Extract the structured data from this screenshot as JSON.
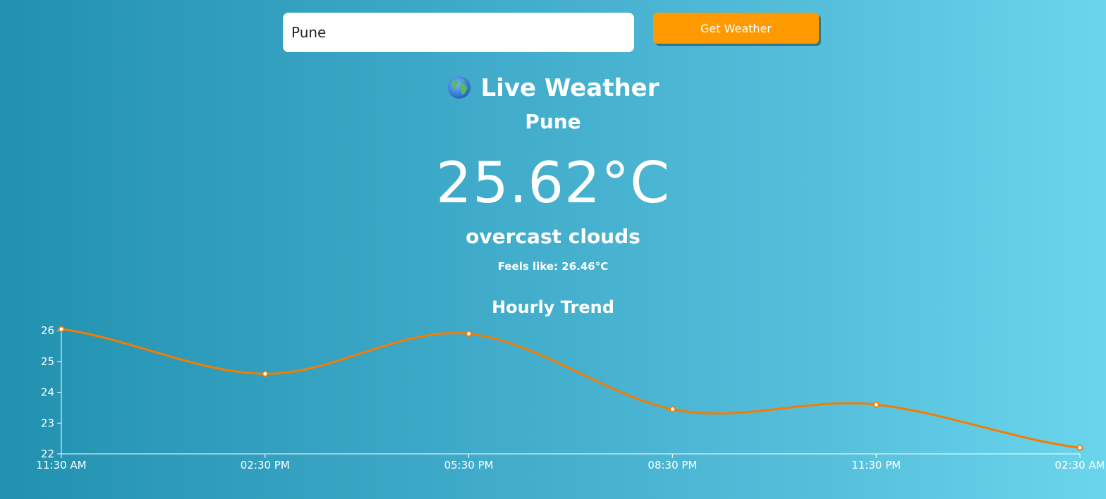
{
  "search": {
    "value": "Pune",
    "placeholder": "",
    "button_label": "Get Weather"
  },
  "header": {
    "title": "Live Weather",
    "icon": "globe-icon"
  },
  "weather": {
    "city": "Pune",
    "temperature": "25.62°C",
    "description": "overcast clouds",
    "feels_like": "Feels like: 26.46°C"
  },
  "colors": {
    "accent": "#ff9900",
    "line": "#f57c00"
  },
  "chart_data": {
    "type": "line",
    "title": "Hourly Trend",
    "categories": [
      "11:30 AM",
      "02:30 PM",
      "05:30 PM",
      "08:30 PM",
      "11:30 PM",
      "02:30 AM"
    ],
    "series": [
      {
        "values": [
          26.05,
          24.6,
          25.9,
          23.45,
          23.6,
          22.2
        ]
      }
    ],
    "y_ticks": [
      22,
      23,
      24,
      25,
      26
    ],
    "ylim": [
      22,
      26.05
    ],
    "grid": false,
    "legend": "none"
  }
}
